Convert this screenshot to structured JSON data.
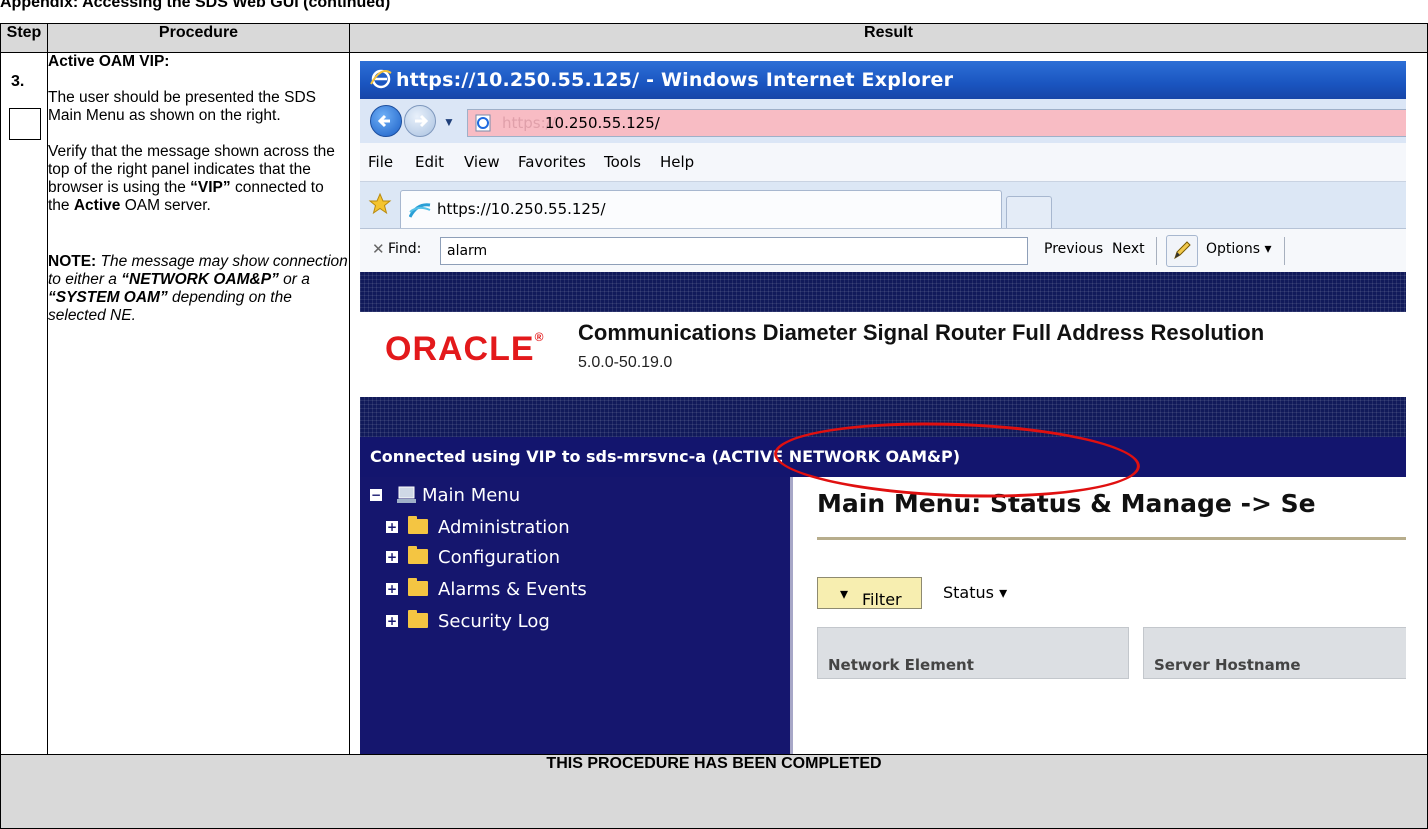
{
  "header_text": "Appendix: Accessing the SDS Web GUI (continued)",
  "table": {
    "headers": [
      "Step",
      "Procedure",
      "Result"
    ],
    "step": "3.",
    "procedure": {
      "title": "Active OAM VIP:",
      "para1": "The user should be presented the SDS Main Menu as shown on the right.",
      "para2_prefix": "Verify that the message shown across the top of the right panel indicates that the browser is using the ",
      "para2_vip": "“VIP”",
      "para2_mid": " connected to the ",
      "para2_active": "Active",
      "para2_suffix": " OAM server.",
      "note_label": "NOTE:",
      "note_part1": " The message may show connection to either a ",
      "note_network": "“NETWORK OAM&P”",
      "note_part2": " or a ",
      "note_system": "“SYSTEM OAM”",
      "note_part3": " depending on the selected NE."
    },
    "footer": "THIS PROCEDURE HAS BEEN COMPLETED"
  },
  "browser": {
    "window_title": "https://10.250.55.125/ - Windows Internet Explorer",
    "url_prefix": "https://",
    "url_host": "10.250.55.125/",
    "menu": [
      "File",
      "Edit",
      "View",
      "Favorites",
      "Tools",
      "Help"
    ],
    "tab_title": "https://10.250.55.125/",
    "find_label": "Find:",
    "find_value": "alarm",
    "find_previous": "Previous",
    "find_next": "Next",
    "find_options": "Options",
    "find_options_arrow": "▾",
    "find_close": "✕"
  },
  "app": {
    "brand": "ORACLE",
    "brand_mark": "®",
    "product_title": "Communications Diameter Signal Router Full Address Resolution",
    "version": "5.0.0-50.19.0",
    "connection_text": "Connected using VIP to sds-mrsvnc-a (ACTIVE NETWORK OAM&P)",
    "nav": {
      "root": "Main Menu",
      "items": [
        "Administration",
        "Configuration",
        "Alarms & Events",
        "Security Log"
      ]
    },
    "page_title": "Main Menu: Status & Manage -> Se",
    "filter_label": "Filter",
    "status_label": "Status",
    "columns": [
      "Network Element",
      "Server Hostname"
    ]
  },
  "colors": {
    "ellipse": "#e01010",
    "nav_bg": "#15166e",
    "brand_red": "#e3191b"
  }
}
